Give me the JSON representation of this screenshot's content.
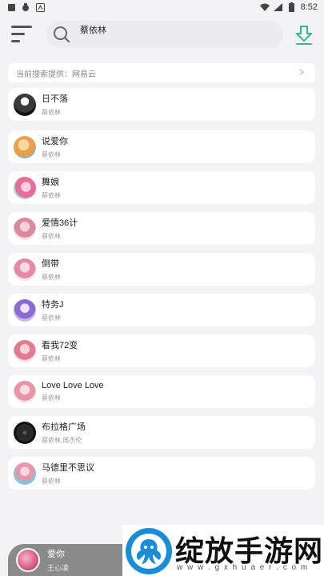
{
  "status_bar": {
    "time": "8:52",
    "left_icons": [
      "notification-icon",
      "bug-icon",
      "app-icon"
    ],
    "right_icons": [
      "wifi-icon",
      "signal-icon",
      "battery-icon"
    ]
  },
  "header": {
    "search_value": "蔡依林",
    "menu_icon": "menu-icon",
    "search_icon": "search-icon",
    "download_icon": "download-icon",
    "accent": "#2fb88a"
  },
  "source": {
    "text": "当前搜索提供：网易云",
    "chevron": "chevron-right-icon"
  },
  "songs": [
    {
      "title": "日不落",
      "artist": "蔡依林",
      "cover": "#3a3a3a"
    },
    {
      "title": "说爱你",
      "artist": "蔡依林",
      "cover": "#e8a04a"
    },
    {
      "title": "舞娘",
      "artist": "蔡依林",
      "cover": "#e76d9a"
    },
    {
      "title": "爱情36计",
      "artist": "蔡依林",
      "cover": "#d98a9e"
    },
    {
      "title": "倒带",
      "artist": "蔡依林",
      "cover": "#e48aa6"
    },
    {
      "title": "特务J",
      "artist": "蔡依林",
      "cover": "#8a6ccf"
    },
    {
      "title": "看我72变",
      "artist": "蔡依林",
      "cover": "#e07b90"
    },
    {
      "title": "Love Love Love",
      "artist": "蔡依林",
      "cover": "#e895a8"
    },
    {
      "title": "布拉格广场",
      "artist": "蔡依林,周杰伦",
      "cover": "#2a2a2a"
    },
    {
      "title": "马德里不思议",
      "artist": "蔡依林",
      "cover": "#7fc6d9"
    }
  ],
  "player": {
    "title": "爱你",
    "artist": "王心凌"
  },
  "watermark": {
    "title": "绽放手游网",
    "url": "w w w . g x h u a e r . c o m"
  }
}
